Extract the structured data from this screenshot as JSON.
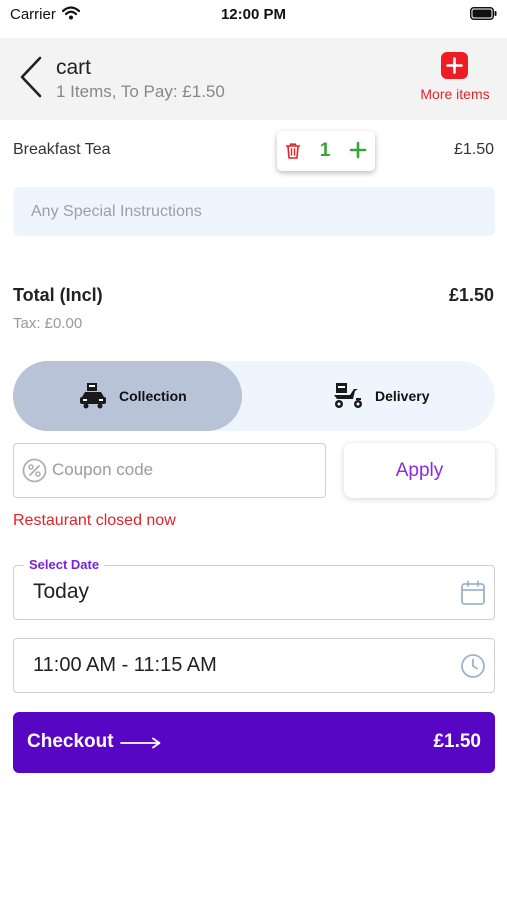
{
  "status_bar": {
    "carrier": "Carrier",
    "time": "12:00 PM",
    "icons": [
      "wifi-icon",
      "battery-icon"
    ]
  },
  "header": {
    "title": "cart",
    "subtitle": "1 Items, To Pay: £1.50",
    "more_items_label": "More items",
    "icons": [
      "chevron-left-icon",
      "plus-icon"
    ]
  },
  "cart": {
    "items": [
      {
        "name": "Breakfast Tea",
        "quantity": "1",
        "price": "£1.50"
      }
    ],
    "instructions_placeholder": "Any Special Instructions"
  },
  "totals": {
    "total_label": "Total (Incl)",
    "total_value": "£1.50",
    "tax_label": "Tax: £0.00"
  },
  "order_mode": {
    "options": [
      {
        "label": "Collection",
        "icon": "collection-car-icon",
        "selected": true
      },
      {
        "label": "Delivery",
        "icon": "delivery-scooter-icon",
        "selected": false
      }
    ]
  },
  "coupon": {
    "placeholder": "Coupon code",
    "value": "",
    "apply_label": "Apply"
  },
  "status_message": "Restaurant closed now",
  "schedule": {
    "date_label": "Select Date",
    "date_value": "Today",
    "time_value": "11:00 AM - 11:15 AM"
  },
  "checkout": {
    "label": "Checkout",
    "total": "£1.50"
  },
  "colors": {
    "accent": "#5706c4",
    "accent_text": "#8a2be2",
    "error": "#e0242a",
    "quantity": "#36a43a",
    "selected_mode": "#b9c3d8",
    "field_bg": "#eef5fc"
  }
}
